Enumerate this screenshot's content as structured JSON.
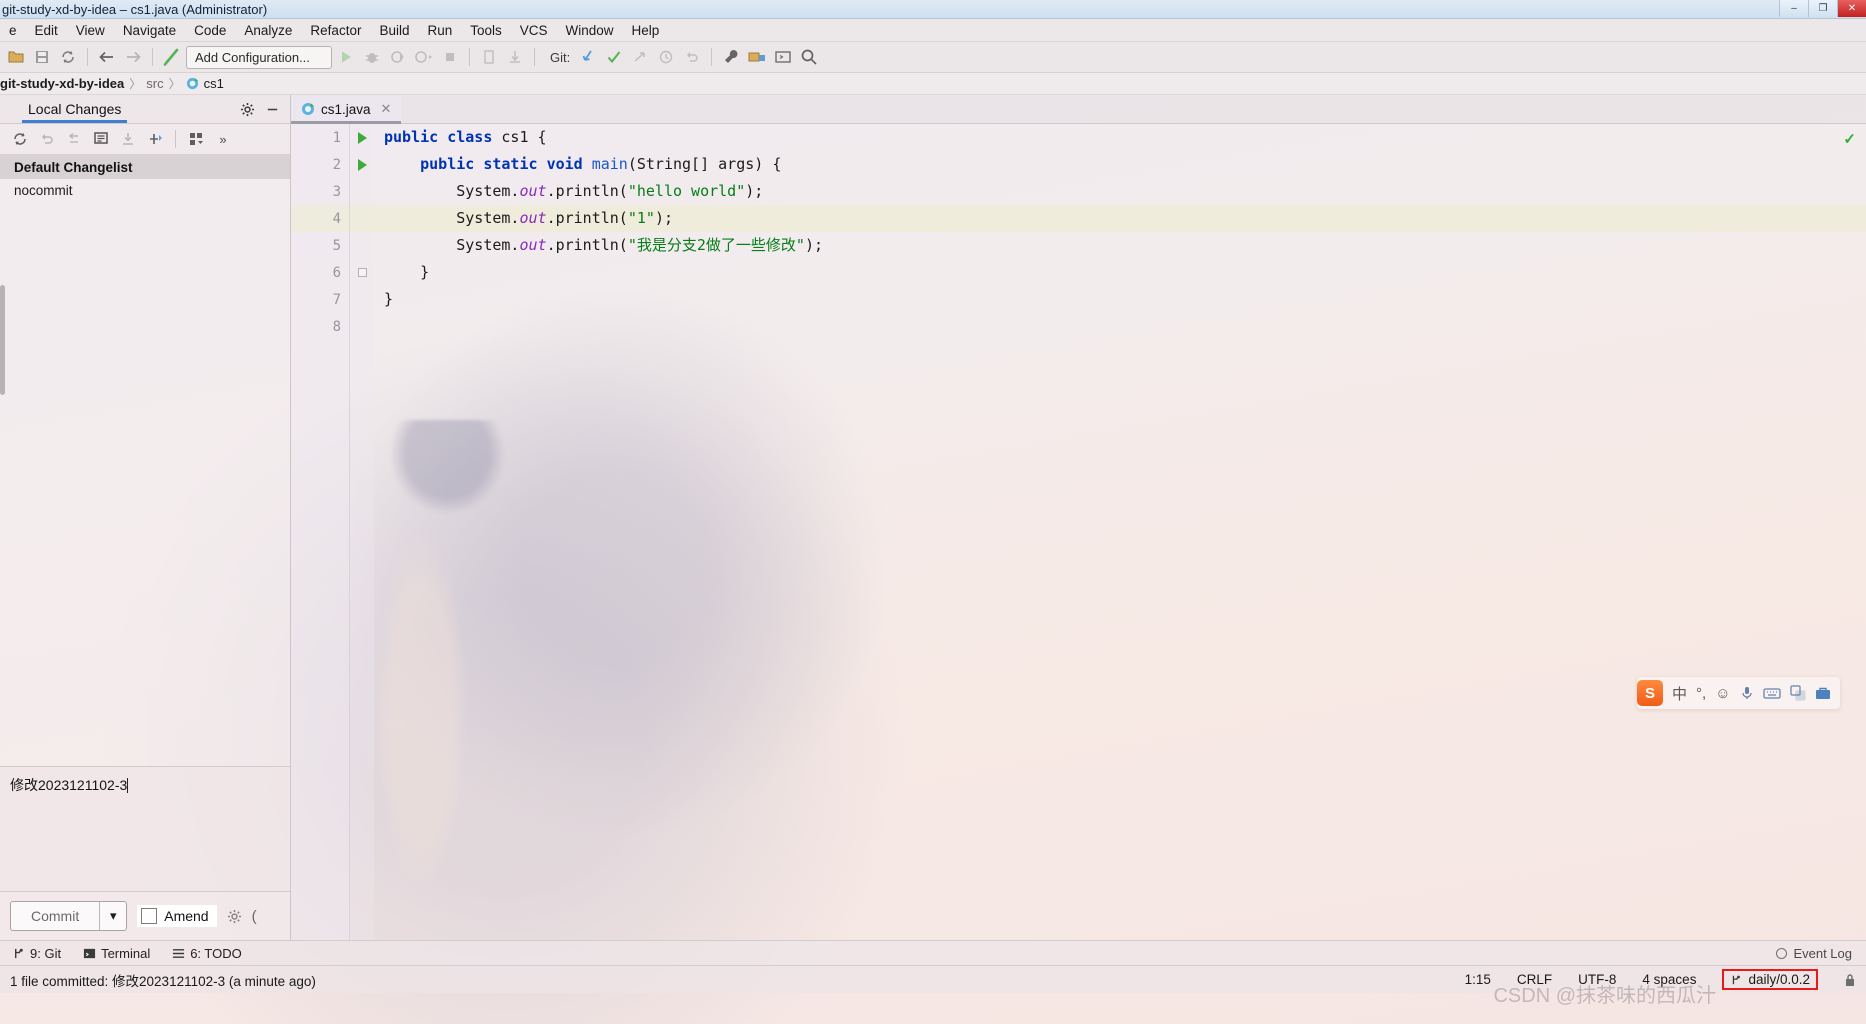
{
  "window": {
    "title": "git-study-xd-by-idea – cs1.java (Administrator)",
    "minimize": "–",
    "maximize": "❐",
    "close": "✕"
  },
  "menubar": {
    "items": [
      "e",
      "Edit",
      "View",
      "Navigate",
      "Code",
      "Analyze",
      "Refactor",
      "Build",
      "Run",
      "Tools",
      "VCS",
      "Window",
      "Help"
    ]
  },
  "toolbar": {
    "run_config_label": "Add Configuration...",
    "git_label": "Git:",
    "icons": [
      "open-folder-icon",
      "save-icon",
      "sync-icon",
      "back-arrow-icon",
      "forward-arrow-icon",
      "build-hammer-icon",
      "run-icon",
      "debug-icon",
      "run-coverage-icon",
      "profile-icon",
      "stop-icon",
      "inspect-icon",
      "update-project-icon",
      "git-update-icon",
      "git-commit-icon",
      "git-push-icon",
      "history-icon",
      "rollback-icon",
      "wrench-icon",
      "project-structure-icon",
      "terminal-icon",
      "search-everywhere-icon"
    ]
  },
  "breadcrumb": {
    "items": [
      "git-study-xd-by-idea",
      "src",
      "cs1"
    ],
    "separator": "〉"
  },
  "vcs_panel": {
    "tab_label": "Local Changes",
    "settings_icon": "gear-icon",
    "hide_icon": "minimize-icon",
    "toolbar_icons": [
      "refresh-icon",
      "rollback-icon",
      "revert-icon",
      "show-diff-icon",
      "get-from-vcs-icon",
      "move-to-changelist-icon",
      "group-by-icon",
      "more-icon"
    ],
    "more_label": "»",
    "changelist_name": "Default Changelist",
    "file_entry": "nocommit",
    "commit_message": "修改2023121102-3",
    "commit_button": "Commit",
    "commit_dropdown_arrow": "▾",
    "amend_label": "Amend",
    "amend_checked": false,
    "commit_settings_icon": "gear-icon"
  },
  "editor": {
    "tab": {
      "label": "cs1.java",
      "icon": "java-class-icon",
      "close": "✕"
    },
    "lines": [
      {
        "num": "1",
        "runmark": true,
        "fold": false,
        "highlight": false,
        "tokens": [
          {
            "t": "public",
            "c": "kw"
          },
          {
            "t": " ",
            "c": "pl"
          },
          {
            "t": "class",
            "c": "kw"
          },
          {
            "t": " ",
            "c": "pl"
          },
          {
            "t": "cs1",
            "c": "cls"
          },
          {
            "t": " {",
            "c": "pl"
          }
        ]
      },
      {
        "num": "2",
        "runmark": true,
        "fold": true,
        "highlight": false,
        "tokens": [
          {
            "t": "    ",
            "c": "pl"
          },
          {
            "t": "public",
            "c": "kw"
          },
          {
            "t": " ",
            "c": "pl"
          },
          {
            "t": "static",
            "c": "kw"
          },
          {
            "t": " ",
            "c": "pl"
          },
          {
            "t": "void",
            "c": "kw"
          },
          {
            "t": " ",
            "c": "pl"
          },
          {
            "t": "main",
            "c": "mth"
          },
          {
            "t": "(String[] args) {",
            "c": "pl"
          }
        ]
      },
      {
        "num": "3",
        "runmark": false,
        "fold": false,
        "highlight": false,
        "tokens": [
          {
            "t": "        System.",
            "c": "pl"
          },
          {
            "t": "out",
            "c": "fld"
          },
          {
            "t": ".println(",
            "c": "pl"
          },
          {
            "t": "\"hello world\"",
            "c": "str"
          },
          {
            "t": ");",
            "c": "pl"
          }
        ]
      },
      {
        "num": "4",
        "runmark": false,
        "fold": false,
        "highlight": true,
        "tokens": [
          {
            "t": "        System.",
            "c": "pl"
          },
          {
            "t": "out",
            "c": "fld"
          },
          {
            "t": ".println(",
            "c": "pl"
          },
          {
            "t": "\"1\"",
            "c": "str"
          },
          {
            "t": ");",
            "c": "pl"
          }
        ]
      },
      {
        "num": "5",
        "runmark": false,
        "fold": false,
        "highlight": false,
        "tokens": [
          {
            "t": "        System.",
            "c": "pl"
          },
          {
            "t": "out",
            "c": "fld"
          },
          {
            "t": ".println(",
            "c": "pl"
          },
          {
            "t": "\"我是分支2做了一些修改\"",
            "c": "str"
          },
          {
            "t": ");",
            "c": "pl"
          }
        ]
      },
      {
        "num": "6",
        "runmark": false,
        "fold": true,
        "highlight": false,
        "tokens": [
          {
            "t": "    }",
            "c": "pl"
          }
        ]
      },
      {
        "num": "7",
        "runmark": false,
        "fold": false,
        "highlight": false,
        "tokens": [
          {
            "t": "}",
            "c": "pl"
          }
        ]
      },
      {
        "num": "8",
        "runmark": false,
        "fold": false,
        "highlight": false,
        "tokens": [
          {
            "t": "",
            "c": "pl"
          }
        ]
      }
    ],
    "inspection_ok_mark": "✓"
  },
  "ime": {
    "logo": "S",
    "mode_label": "中",
    "items": [
      "ime-mode-chinese",
      "ime-punctuation-icon",
      "ime-emoji-icon",
      "ime-voice-icon",
      "ime-keyboard-icon",
      "ime-translate-icon",
      "ime-toolbox-icon"
    ]
  },
  "bottom_tools": {
    "items": [
      {
        "label": "9: Git",
        "icon": "git-branch-icon"
      },
      {
        "label": "Terminal",
        "icon": "terminal-icon"
      },
      {
        "label": "6: TODO",
        "icon": "todo-list-icon"
      }
    ],
    "event_log": "Event Log"
  },
  "statusbar": {
    "message": "1 file committed: 修改2023121102-3 (a minute ago)",
    "caret_position": "1:15",
    "line_separator": "CRLF",
    "encoding": "UTF-8",
    "indent": "4 spaces",
    "branch": "daily/0.0.2",
    "branch_icon": "git-branch-icon",
    "lock_icon": "read-only-lock-icon",
    "watermark": "CSDN @抹茶味的西瓜汁",
    "branch_highlight_color": "#e81b1b"
  },
  "colors": {
    "accent_tab": "#3e7fd0",
    "keyword": "#0033b3",
    "string": "#067d17",
    "field": "#8a2bba",
    "method": "#1b57c4",
    "run_green": "#3cab3c"
  }
}
